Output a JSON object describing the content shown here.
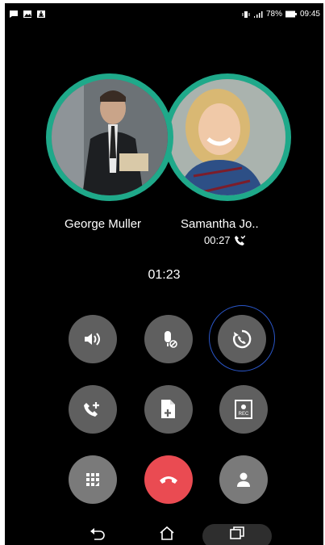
{
  "status_bar": {
    "left_icons": [
      "message-icon",
      "image-icon",
      "download-icon"
    ],
    "battery_percent": "78%",
    "time": "09:45"
  },
  "participants": [
    {
      "name": "George Muller",
      "avatar": "george-muller-photo"
    },
    {
      "name": "Samantha Jo..",
      "avatar": "samantha-photo",
      "sub_duration": "00:27"
    }
  ],
  "call_timer": "01:23",
  "controls": [
    {
      "id": "speaker",
      "icon": "speaker-icon"
    },
    {
      "id": "mute",
      "icon": "mic-off-icon"
    },
    {
      "id": "swap",
      "icon": "swap-calls-icon",
      "active": true
    },
    {
      "id": "add-call",
      "icon": "add-call-icon"
    },
    {
      "id": "add-note",
      "icon": "note-add-icon"
    },
    {
      "id": "record",
      "icon": "rec-icon",
      "label": "REC"
    },
    {
      "id": "keypad",
      "icon": "keypad-icon"
    },
    {
      "id": "end-call",
      "icon": "end-call-icon",
      "color": "#ea4b52"
    },
    {
      "id": "contact",
      "icon": "contact-icon"
    }
  ],
  "colors": {
    "accent_ring": "#1fa98a",
    "end_call": "#ea4b52",
    "button": "#5f5f5f",
    "focus_ring": "#2a56c8"
  }
}
